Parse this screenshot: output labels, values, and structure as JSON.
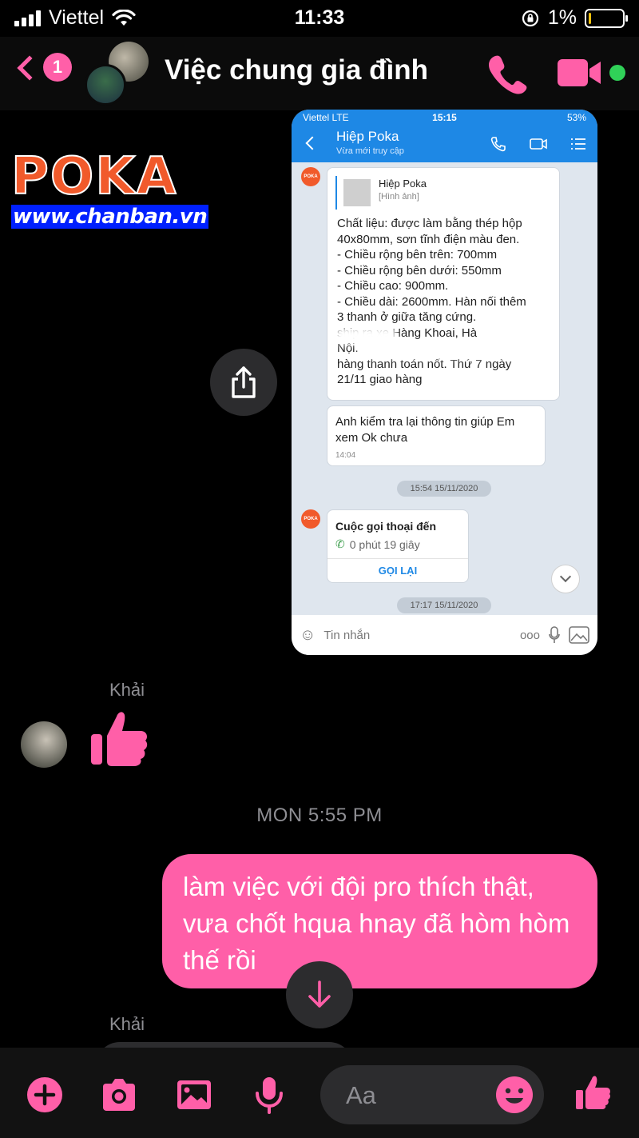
{
  "status_bar": {
    "carrier": "Viettel",
    "time": "11:33",
    "battery": "1%",
    "battery_level": 0.01
  },
  "header": {
    "back_badge": "1",
    "title": "Việc chung gia đình"
  },
  "watermark": {
    "brand": "POKA",
    "url": "www.chanban.vn"
  },
  "shared_screenshot": {
    "status": {
      "carrier": "Viettel  LTE",
      "time": "15:15",
      "battery": "53%"
    },
    "contact_name": "Hiệp Poka",
    "contact_status": "Vừa mới truy cập",
    "avatar_text": "POKA",
    "quote": {
      "name": "Hiệp Poka",
      "sub": "[Hình ảnh]"
    },
    "message": "Chất liệu: được làm bằng thép hộp\n40x80mm, sơn tĩnh điện màu đen.\n- Chiều rộng bên trên: 700mm\n- Chiều rộng bên dưới: 550mm\n- Chiều cao: 900mm.\n- Chiều dài: 2600mm. Hàn nối thêm\n3 thanh ở giữa tăng cứng.\n         ship ra xe Hàng Khoai, Hà\nNội.\nhàng thanh toán nốt. Thứ 7 ngày\n21/11 giao hàng",
    "reply": "Anh kiểm tra lại thông tin giúp Em\nxem Ok chưa",
    "reply_time": "14:04",
    "date1": "15:54 15/11/2020",
    "call_title": "Cuộc gọi thoại đến",
    "call_duration": "0 phút 19 giây",
    "call_back": "GỌI LẠI",
    "date2": "17:17 15/11/2020",
    "input_placeholder": "Tin nhắn",
    "more": "ooo"
  },
  "thread": {
    "sender1": "Khải",
    "timestamp": "MON 5:55 PM",
    "my_message": "làm việc với đội pro thích thật, vưa chốt hqua hnay đã hòm hòm thế rồi",
    "sender2": "Khải"
  },
  "composer": {
    "placeholder": "Aa"
  },
  "colors": {
    "accent": "#ff5fa8",
    "online": "#30d158",
    "zalo_blue": "#1e88e5",
    "poka_orange": "#f15a2b"
  },
  "icons": [
    "signal-icon",
    "wifi-icon",
    "rotation-lock-icon",
    "battery-icon",
    "back-chevron-icon",
    "phone-icon",
    "video-icon",
    "share-icon",
    "like-icon",
    "arrow-down-icon",
    "plus-icon",
    "camera-icon",
    "image-icon",
    "mic-icon",
    "emoji-icon"
  ]
}
